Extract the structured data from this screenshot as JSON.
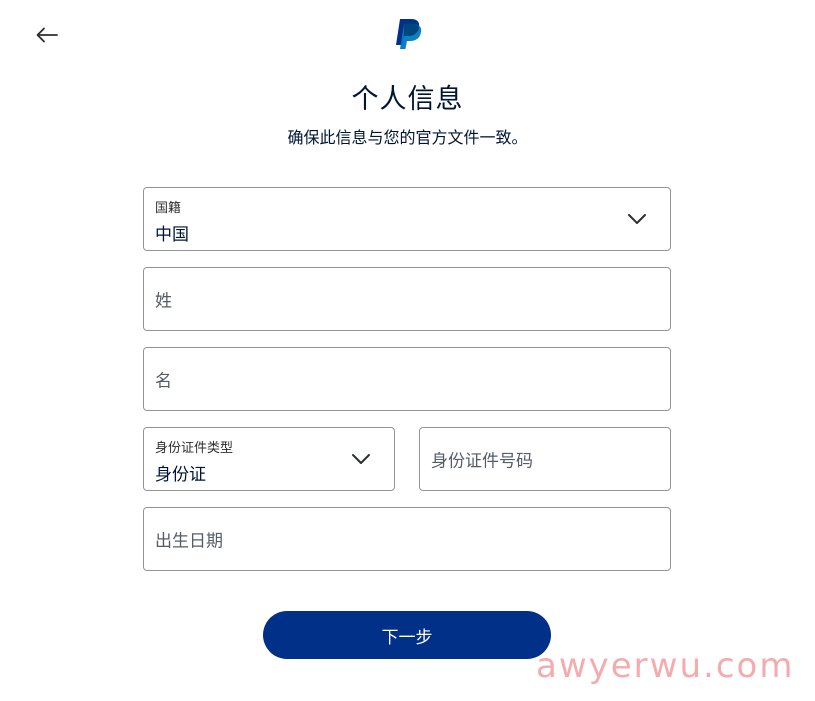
{
  "header": {
    "back_icon": "arrow-left-icon",
    "logo_icon": "paypal-logo-icon"
  },
  "heading": {
    "title": "个人信息",
    "subtitle": "确保此信息与您的官方文件一致。"
  },
  "form": {
    "nationality": {
      "label": "国籍",
      "value": "中国",
      "icon": "chevron-down-icon"
    },
    "last_name": {
      "placeholder": "姓"
    },
    "first_name": {
      "placeholder": "名"
    },
    "id_type": {
      "label": "身份证件类型",
      "value": "身份证",
      "icon": "chevron-down-icon"
    },
    "id_number": {
      "placeholder": "身份证件号码"
    },
    "birth_date": {
      "placeholder": "出生日期"
    }
  },
  "actions": {
    "next_label": "下一步"
  },
  "watermark": {
    "text": "awyerwu.com"
  },
  "colors": {
    "primary_button": "#003087",
    "text": "#001435",
    "border": "#929496",
    "watermark": "#f3a3a6"
  }
}
